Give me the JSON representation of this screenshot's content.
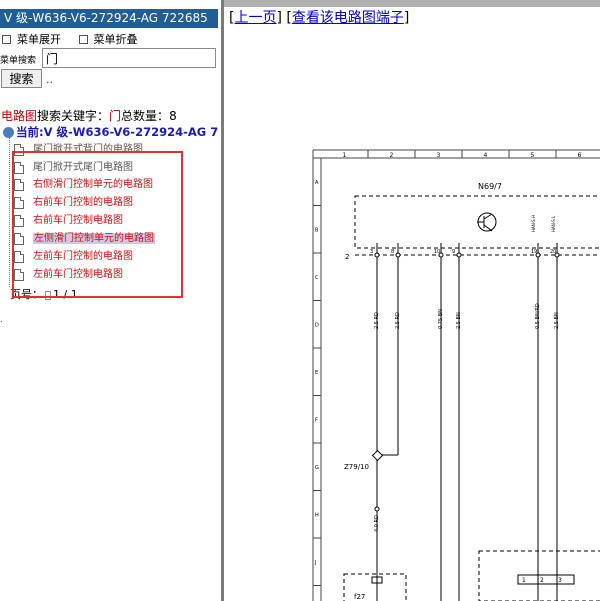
{
  "header": {
    "model": "V 级-W636-V6-272924-AG 722685"
  },
  "menu": {
    "expand_label": "菜单展开",
    "collapse_label": "菜单折叠"
  },
  "search": {
    "label": "菜单搜索",
    "value": "门",
    "button": "搜索",
    "dots": ".."
  },
  "results": {
    "prefix": "电路图",
    "keyword_label": "搜索关键字：",
    "keyword": "门",
    "count_label": "总数量：",
    "count": "8"
  },
  "current": {
    "label": "当前:V 级-W636-V6-272924-AG 7"
  },
  "tree": {
    "items": [
      {
        "label": "尾门掀开式背门的电路图",
        "color": "gray"
      },
      {
        "label": "尾门掀开式尾门电路图",
        "color": "gray"
      },
      {
        "label": "右侧滑门控制单元的电路图",
        "color": "red"
      },
      {
        "label": "右前车门控制的电路图",
        "color": "red"
      },
      {
        "label": "右前车门控制电路图",
        "color": "red"
      },
      {
        "label": "左侧滑门控制单元的电路图",
        "color": "red",
        "selected": true
      },
      {
        "label": "左前车门控制的电路图",
        "color": "red"
      },
      {
        "label": "左前车门控制电路图",
        "color": "red"
      }
    ]
  },
  "pager": {
    "label": "页号：",
    "value": "1 / 1"
  },
  "stray": ".",
  "nav": {
    "prev_label": "上一页",
    "terminals_label": "查看该电路图端子"
  },
  "diagram": {
    "columns": [
      "1",
      "2",
      "3",
      "4",
      "5",
      "6"
    ],
    "rows": [
      "A",
      "B",
      "C",
      "D",
      "E",
      "F",
      "G",
      "H",
      "J"
    ],
    "component_top": "N69/7",
    "row_marker": "2",
    "pins": [
      "3",
      "8",
      "10",
      "9",
      "19",
      "20"
    ],
    "pin_signals": [
      "HAN-S H",
      "HAN-S L"
    ],
    "wires": [
      "2.5 RD",
      "2.5 RD",
      "0.75 BN",
      "2.5 BN",
      "0.5 BN/RD",
      "2.5 BN"
    ],
    "splice": "Z79/10",
    "lower_wire": "4.0 RD",
    "fuse": "f27",
    "bottom_pins": [
      "1",
      "2",
      "3"
    ],
    "colors": {
      "line": "#000000",
      "grid": "#444444"
    }
  }
}
